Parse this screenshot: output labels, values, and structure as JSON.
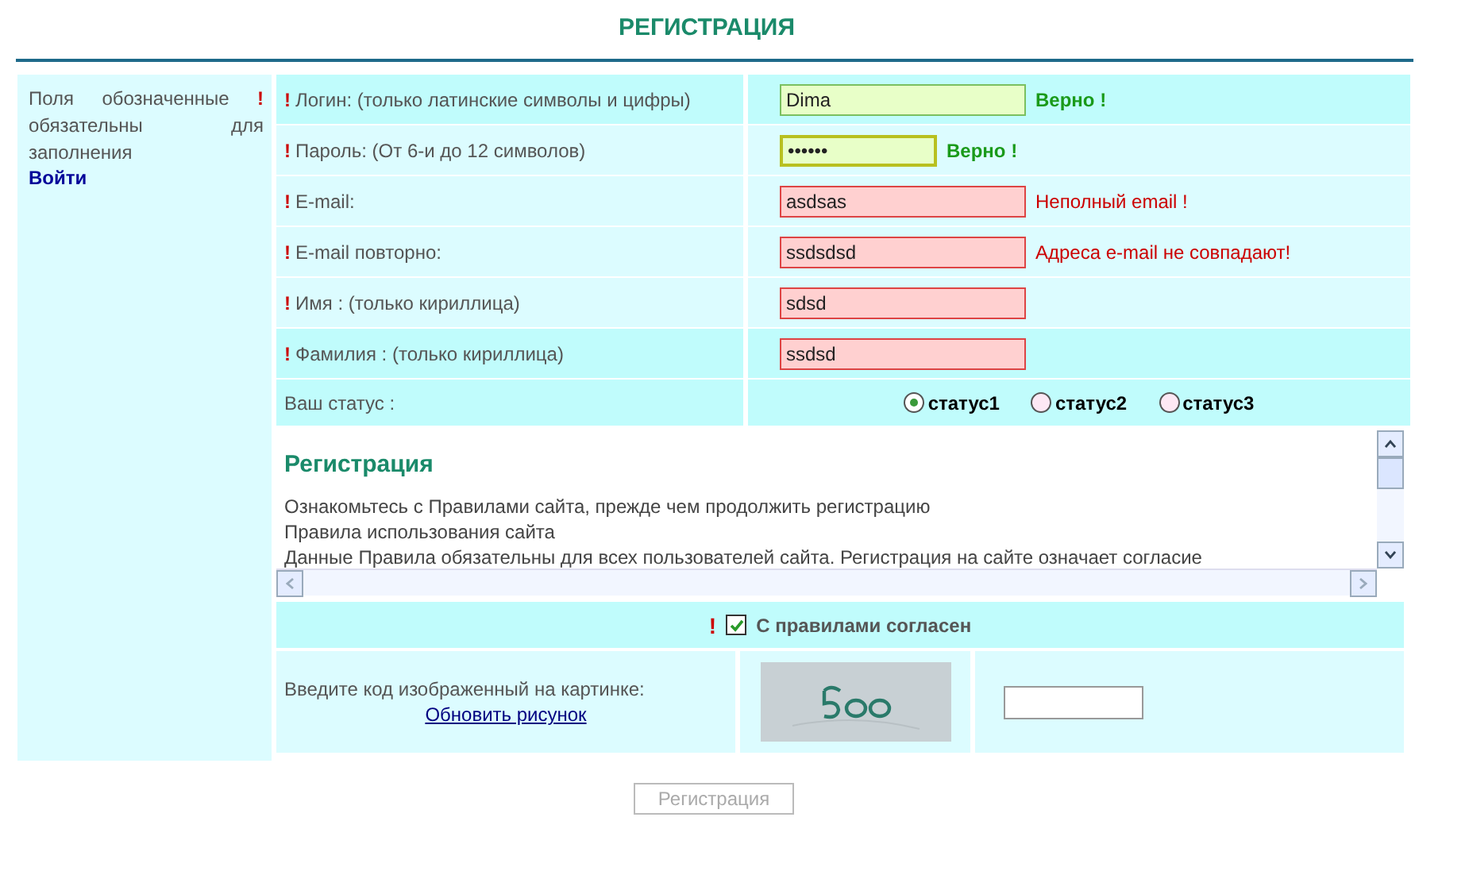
{
  "page_title": "РЕГИСТРАЦИЯ",
  "sidebar": {
    "note": "Поля обозначенные",
    "mark": "!",
    "note_rest": "обязательны для заполнения",
    "login_link": "Войти"
  },
  "fields": [
    {
      "mark": "!",
      "label": "Логин: (только латинские символы и цифры)",
      "kind": "text",
      "value": "Dima",
      "valid": true,
      "focused": false,
      "message": "Верно !"
    },
    {
      "mark": "!",
      "label": "Пароль: (От 6-и до 12 символов)",
      "kind": "password",
      "value": "••••••",
      "valid": true,
      "focused": true,
      "message": "Верно !"
    },
    {
      "mark": "!",
      "label": "E-mail:",
      "kind": "text",
      "value": "asdsas",
      "valid": false,
      "focused": false,
      "message": "Неполный email !"
    },
    {
      "mark": "!",
      "label": "E-mail повторно:",
      "kind": "text",
      "value": "ssdsdsd",
      "valid": false,
      "focused": false,
      "message": "Адреса e-mail не совпадают!"
    },
    {
      "mark": "!",
      "label": "Имя : (только кириллица)",
      "kind": "text",
      "value": "sdsd",
      "valid": false,
      "focused": false
    },
    {
      "mark": "!",
      "label": "Фамилия : (только кириллица)",
      "kind": "text",
      "value": "ssdsd",
      "valid": false,
      "focused": false
    }
  ],
  "status": {
    "label": "Ваш статус :",
    "options": [
      {
        "label": "статус1",
        "selected": true
      },
      {
        "label": "статус2",
        "selected": false
      },
      {
        "label": "статус3",
        "selected": false
      }
    ]
  },
  "rules": {
    "heading": "Регистрация",
    "lines": [
      "Ознакомьтесь с Правилами сайта, прежде чем продолжить регистрацию",
      "Правила использования сайта",
      "Данные Правила обязательны для всех пользователей сайта. Регистрация на сайте означает согласие"
    ]
  },
  "agree": {
    "mark": "!",
    "label": "С правилами согласен",
    "checked": true
  },
  "captcha": {
    "prompt": "Введите код изображенный на картинке:",
    "refresh_link": "Обновить рисунок",
    "kind": "picture"
  },
  "submit": {
    "label": "Регистрация",
    "disabled": true
  }
}
